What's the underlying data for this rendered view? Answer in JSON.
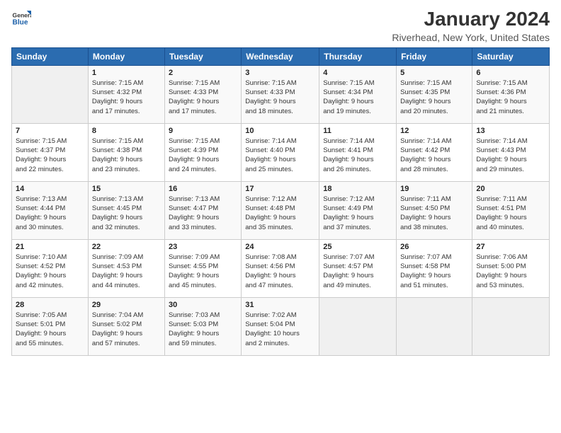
{
  "header": {
    "logo_line1": "General",
    "logo_line2": "Blue",
    "month": "January 2024",
    "location": "Riverhead, New York, United States"
  },
  "weekdays": [
    "Sunday",
    "Monday",
    "Tuesday",
    "Wednesday",
    "Thursday",
    "Friday",
    "Saturday"
  ],
  "weeks": [
    [
      {
        "day": "",
        "info": ""
      },
      {
        "day": "1",
        "info": "Sunrise: 7:15 AM\nSunset: 4:32 PM\nDaylight: 9 hours\nand 17 minutes."
      },
      {
        "day": "2",
        "info": "Sunrise: 7:15 AM\nSunset: 4:33 PM\nDaylight: 9 hours\nand 17 minutes."
      },
      {
        "day": "3",
        "info": "Sunrise: 7:15 AM\nSunset: 4:33 PM\nDaylight: 9 hours\nand 18 minutes."
      },
      {
        "day": "4",
        "info": "Sunrise: 7:15 AM\nSunset: 4:34 PM\nDaylight: 9 hours\nand 19 minutes."
      },
      {
        "day": "5",
        "info": "Sunrise: 7:15 AM\nSunset: 4:35 PM\nDaylight: 9 hours\nand 20 minutes."
      },
      {
        "day": "6",
        "info": "Sunrise: 7:15 AM\nSunset: 4:36 PM\nDaylight: 9 hours\nand 21 minutes."
      }
    ],
    [
      {
        "day": "7",
        "info": "Sunrise: 7:15 AM\nSunset: 4:37 PM\nDaylight: 9 hours\nand 22 minutes."
      },
      {
        "day": "8",
        "info": "Sunrise: 7:15 AM\nSunset: 4:38 PM\nDaylight: 9 hours\nand 23 minutes."
      },
      {
        "day": "9",
        "info": "Sunrise: 7:15 AM\nSunset: 4:39 PM\nDaylight: 9 hours\nand 24 minutes."
      },
      {
        "day": "10",
        "info": "Sunrise: 7:14 AM\nSunset: 4:40 PM\nDaylight: 9 hours\nand 25 minutes."
      },
      {
        "day": "11",
        "info": "Sunrise: 7:14 AM\nSunset: 4:41 PM\nDaylight: 9 hours\nand 26 minutes."
      },
      {
        "day": "12",
        "info": "Sunrise: 7:14 AM\nSunset: 4:42 PM\nDaylight: 9 hours\nand 28 minutes."
      },
      {
        "day": "13",
        "info": "Sunrise: 7:14 AM\nSunset: 4:43 PM\nDaylight: 9 hours\nand 29 minutes."
      }
    ],
    [
      {
        "day": "14",
        "info": "Sunrise: 7:13 AM\nSunset: 4:44 PM\nDaylight: 9 hours\nand 30 minutes."
      },
      {
        "day": "15",
        "info": "Sunrise: 7:13 AM\nSunset: 4:45 PM\nDaylight: 9 hours\nand 32 minutes."
      },
      {
        "day": "16",
        "info": "Sunrise: 7:13 AM\nSunset: 4:47 PM\nDaylight: 9 hours\nand 33 minutes."
      },
      {
        "day": "17",
        "info": "Sunrise: 7:12 AM\nSunset: 4:48 PM\nDaylight: 9 hours\nand 35 minutes."
      },
      {
        "day": "18",
        "info": "Sunrise: 7:12 AM\nSunset: 4:49 PM\nDaylight: 9 hours\nand 37 minutes."
      },
      {
        "day": "19",
        "info": "Sunrise: 7:11 AM\nSunset: 4:50 PM\nDaylight: 9 hours\nand 38 minutes."
      },
      {
        "day": "20",
        "info": "Sunrise: 7:11 AM\nSunset: 4:51 PM\nDaylight: 9 hours\nand 40 minutes."
      }
    ],
    [
      {
        "day": "21",
        "info": "Sunrise: 7:10 AM\nSunset: 4:52 PM\nDaylight: 9 hours\nand 42 minutes."
      },
      {
        "day": "22",
        "info": "Sunrise: 7:09 AM\nSunset: 4:53 PM\nDaylight: 9 hours\nand 44 minutes."
      },
      {
        "day": "23",
        "info": "Sunrise: 7:09 AM\nSunset: 4:55 PM\nDaylight: 9 hours\nand 45 minutes."
      },
      {
        "day": "24",
        "info": "Sunrise: 7:08 AM\nSunset: 4:56 PM\nDaylight: 9 hours\nand 47 minutes."
      },
      {
        "day": "25",
        "info": "Sunrise: 7:07 AM\nSunset: 4:57 PM\nDaylight: 9 hours\nand 49 minutes."
      },
      {
        "day": "26",
        "info": "Sunrise: 7:07 AM\nSunset: 4:58 PM\nDaylight: 9 hours\nand 51 minutes."
      },
      {
        "day": "27",
        "info": "Sunrise: 7:06 AM\nSunset: 5:00 PM\nDaylight: 9 hours\nand 53 minutes."
      }
    ],
    [
      {
        "day": "28",
        "info": "Sunrise: 7:05 AM\nSunset: 5:01 PM\nDaylight: 9 hours\nand 55 minutes."
      },
      {
        "day": "29",
        "info": "Sunrise: 7:04 AM\nSunset: 5:02 PM\nDaylight: 9 hours\nand 57 minutes."
      },
      {
        "day": "30",
        "info": "Sunrise: 7:03 AM\nSunset: 5:03 PM\nDaylight: 9 hours\nand 59 minutes."
      },
      {
        "day": "31",
        "info": "Sunrise: 7:02 AM\nSunset: 5:04 PM\nDaylight: 10 hours\nand 2 minutes."
      },
      {
        "day": "",
        "info": ""
      },
      {
        "day": "",
        "info": ""
      },
      {
        "day": "",
        "info": ""
      }
    ]
  ]
}
